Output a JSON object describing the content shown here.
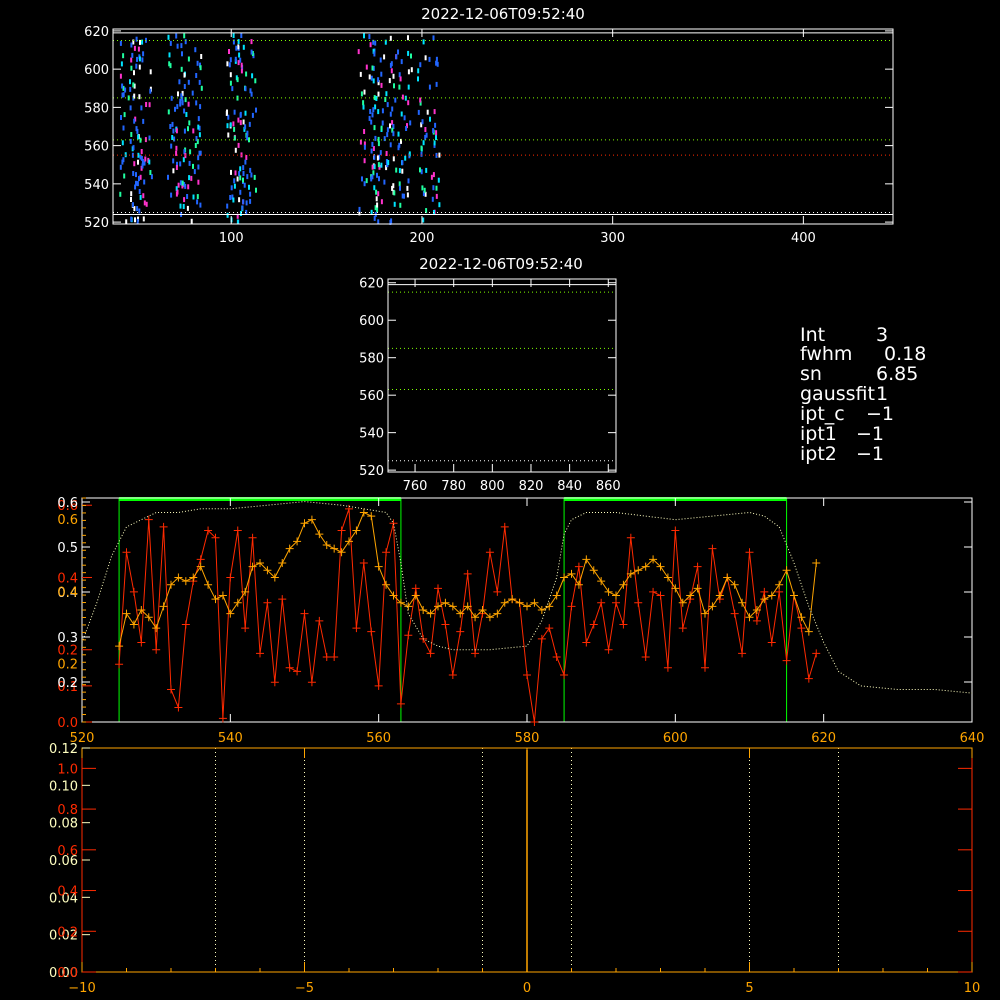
{
  "colors": {
    "background": "#000000",
    "axis": "#ffffff",
    "red": "#ff2a00",
    "orange": "#ffa500",
    "green": "#00ff00",
    "green_dot": "#7fff00",
    "cream": "#ffffc0",
    "blue": "#2266ff",
    "cyan": "#00e5ff",
    "magenta": "#ff33cc",
    "teal": "#20ffa0"
  },
  "info": {
    "int_label": "Int",
    "int_value": "3",
    "fwhm_label": "fwhm",
    "fwhm_value": "0.18",
    "sn_label": "sn",
    "sn_value": "6.85",
    "gaussfit_label": "gaussfit",
    "gaussfit_value": "1",
    "ipt_c_label": "ipt_c",
    "ipt_c_value": "−1",
    "ipt1_label": "ipt1",
    "ipt1_value": "−1",
    "ipt2_label": "ipt2",
    "ipt2_value": "−1"
  },
  "chart_data": [
    {
      "type": "heatmap",
      "id": "top-image",
      "title": "2022-12-06T09:52:40",
      "xlim": [
        38,
        447
      ],
      "ylim": [
        519,
        621
      ],
      "xticks": [
        100,
        200,
        300,
        400
      ],
      "yticks": [
        520,
        540,
        560,
        580,
        600,
        620
      ],
      "hlines": [
        {
          "y": 619,
          "style": "solid",
          "color": "axis"
        },
        {
          "y": 615,
          "style": "dotted",
          "color": "green_dot"
        },
        {
          "y": 585,
          "style": "dotted",
          "color": "green_dot"
        },
        {
          "y": 563,
          "style": "dotted",
          "color": "green_dot"
        },
        {
          "y": 555,
          "style": "dotted",
          "color": "red"
        },
        {
          "y": 525,
          "style": "dotted",
          "color": "axis"
        },
        {
          "y": 524,
          "style": "solid",
          "color": "axis"
        }
      ]
    },
    {
      "type": "heatmap",
      "id": "middle-image",
      "title": "2022-12-06T09:52:40",
      "xlim": [
        746,
        864
      ],
      "ylim": [
        519,
        622
      ],
      "xticks": [
        760,
        780,
        800,
        820,
        840,
        860
      ],
      "yticks": [
        520,
        540,
        560,
        580,
        600,
        620
      ],
      "hlines": [
        {
          "y": 619,
          "style": "solid",
          "color": "axis"
        },
        {
          "y": 615,
          "style": "dotted",
          "color": "green_dot"
        },
        {
          "y": 585,
          "style": "dotted",
          "color": "green_dot"
        },
        {
          "y": 563,
          "style": "dotted",
          "color": "green_dot"
        },
        {
          "y": 525,
          "style": "dotted",
          "color": "axis"
        }
      ]
    },
    {
      "type": "line",
      "id": "profile-plot",
      "xlim": [
        520,
        640
      ],
      "xticks": [
        520,
        540,
        560,
        580,
        600,
        620,
        640
      ],
      "ylim_left": [
        0,
        0.62
      ],
      "yticks_left_red": [
        0.0,
        0.1,
        0.2,
        0.4,
        0.6
      ],
      "yticks_left_white": [
        0.2,
        0.3,
        0.4,
        0.5,
        0.6
      ],
      "yticks_left_orange": [
        0.2,
        0.4,
        0.6
      ],
      "boxes": [
        {
          "x0": 525,
          "x1": 563
        },
        {
          "x0": 585,
          "x1": 615
        }
      ],
      "series": [
        {
          "color": "red",
          "x": [
            525,
            526,
            527,
            528,
            529,
            530,
            531,
            532,
            533,
            534,
            535,
            536,
            537,
            538,
            539,
            540,
            541,
            542,
            543,
            544,
            545,
            546,
            547,
            548,
            549,
            550,
            551,
            552,
            553,
            554,
            555,
            556,
            557,
            558,
            559,
            560,
            561,
            562,
            563,
            564,
            565,
            566,
            567,
            568,
            569,
            570,
            571,
            572,
            573,
            574,
            575,
            576,
            577,
            578,
            579,
            580,
            581,
            582,
            583,
            584,
            585,
            586,
            587,
            588,
            589,
            590,
            591,
            592,
            593,
            594,
            595,
            596,
            597,
            598,
            599,
            600,
            601,
            602,
            603,
            604,
            605,
            606,
            607,
            608,
            609,
            610,
            611,
            612,
            613,
            614,
            615,
            616,
            617,
            618,
            619
          ],
          "y": [
            0.16,
            0.47,
            0.36,
            0.22,
            0.56,
            0.2,
            0.54,
            0.09,
            0.04,
            0.27,
            0.39,
            0.45,
            0.53,
            0.51,
            0.01,
            0.4,
            0.53,
            0.26,
            0.51,
            0.19,
            0.33,
            0.11,
            0.34,
            0.15,
            0.14,
            0.3,
            0.11,
            0.28,
            0.18,
            0.18,
            0.53,
            0.59,
            0.26,
            0.44,
            0.25,
            0.1,
            0.47,
            0.55,
            0.05,
            0.24,
            0.37,
            0.23,
            0.19,
            0.37,
            0.27,
            0.13,
            0.25,
            0.41,
            0.19,
            0.3,
            0.47,
            0.36,
            0.54,
            0.34,
            0.33,
            0.13,
            0.0,
            0.23,
            0.26,
            0.18,
            0.13,
            0.32,
            0.43,
            0.22,
            0.27,
            0.33,
            0.2,
            0.33,
            0.27,
            0.51,
            0.33,
            0.18,
            0.36,
            0.35,
            0.15,
            0.53,
            0.26,
            0.34,
            0.43,
            0.15,
            0.48,
            0.34,
            0.4,
            0.3,
            0.19,
            0.47,
            0.28,
            0.36,
            0.22,
            0.36,
            0.17,
            0.35,
            0.26,
            0.12,
            0.19
          ]
        },
        {
          "color": "orange",
          "x": [
            525,
            526,
            527,
            528,
            529,
            530,
            531,
            532,
            533,
            534,
            535,
            536,
            537,
            538,
            539,
            540,
            541,
            542,
            543,
            544,
            545,
            546,
            547,
            548,
            549,
            550,
            551,
            552,
            553,
            554,
            555,
            556,
            557,
            558,
            559,
            560,
            561,
            562,
            563,
            564,
            565,
            566,
            567,
            568,
            569,
            570,
            571,
            572,
            573,
            574,
            575,
            576,
            577,
            578,
            579,
            580,
            581,
            582,
            583,
            584,
            585,
            586,
            587,
            588,
            589,
            590,
            591,
            592,
            593,
            594,
            595,
            596,
            597,
            598,
            599,
            600,
            601,
            602,
            603,
            604,
            605,
            606,
            607,
            608,
            609,
            610,
            611,
            612,
            613,
            614,
            615,
            616,
            617,
            618,
            619
          ],
          "y": [
            0.21,
            0.3,
            0.27,
            0.31,
            0.29,
            0.26,
            0.32,
            0.38,
            0.4,
            0.39,
            0.4,
            0.43,
            0.38,
            0.34,
            0.35,
            0.3,
            0.33,
            0.36,
            0.43,
            0.44,
            0.42,
            0.4,
            0.44,
            0.48,
            0.5,
            0.55,
            0.56,
            0.52,
            0.49,
            0.48,
            0.47,
            0.5,
            0.53,
            0.58,
            0.57,
            0.43,
            0.38,
            0.35,
            0.33,
            0.32,
            0.35,
            0.31,
            0.3,
            0.32,
            0.33,
            0.32,
            0.3,
            0.32,
            0.29,
            0.31,
            0.29,
            0.3,
            0.33,
            0.34,
            0.33,
            0.32,
            0.33,
            0.31,
            0.32,
            0.35,
            0.4,
            0.41,
            0.38,
            0.45,
            0.42,
            0.39,
            0.36,
            0.35,
            0.38,
            0.41,
            0.42,
            0.43,
            0.45,
            0.43,
            0.4,
            0.37,
            0.33,
            0.35,
            0.37,
            0.3,
            0.32,
            0.35,
            0.4,
            0.38,
            0.33,
            0.29,
            0.31,
            0.34,
            0.35,
            0.38,
            0.42,
            0.35,
            0.29,
            0.25,
            0.44
          ]
        },
        {
          "color": "cream",
          "style": "dotted",
          "x": [
            520,
            522,
            524,
            526,
            528,
            530,
            533,
            536,
            540,
            545,
            550,
            555,
            558,
            561,
            562,
            563,
            564,
            566,
            568,
            570,
            575,
            580,
            582,
            584,
            585,
            586,
            588,
            592,
            596,
            600,
            605,
            610,
            612,
            614,
            616,
            618,
            620,
            622,
            625,
            630,
            635,
            640
          ],
          "y": [
            0.22,
            0.33,
            0.46,
            0.54,
            0.56,
            0.58,
            0.58,
            0.59,
            0.59,
            0.6,
            0.61,
            0.6,
            0.59,
            0.58,
            0.55,
            0.44,
            0.3,
            0.23,
            0.21,
            0.2,
            0.2,
            0.21,
            0.28,
            0.4,
            0.52,
            0.56,
            0.58,
            0.58,
            0.57,
            0.56,
            0.57,
            0.58,
            0.57,
            0.54,
            0.44,
            0.32,
            0.22,
            0.14,
            0.1,
            0.09,
            0.09,
            0.08
          ]
        }
      ]
    },
    {
      "type": "line",
      "id": "gauss-plot",
      "xlim": [
        -10,
        10
      ],
      "xticks": [
        -10,
        -5,
        0,
        5,
        10
      ],
      "ylim": [
        0,
        0.12
      ],
      "yticks_cream": [
        0.0,
        0.02,
        0.04,
        0.06,
        0.08,
        0.1,
        0.12
      ],
      "yticks_red": [
        0.0,
        0.2,
        0.4,
        0.6,
        0.8,
        1.0
      ],
      "vlines_dotted": [
        -7,
        -5,
        -1,
        1,
        5,
        7
      ],
      "vline_solid": 0
    }
  ]
}
